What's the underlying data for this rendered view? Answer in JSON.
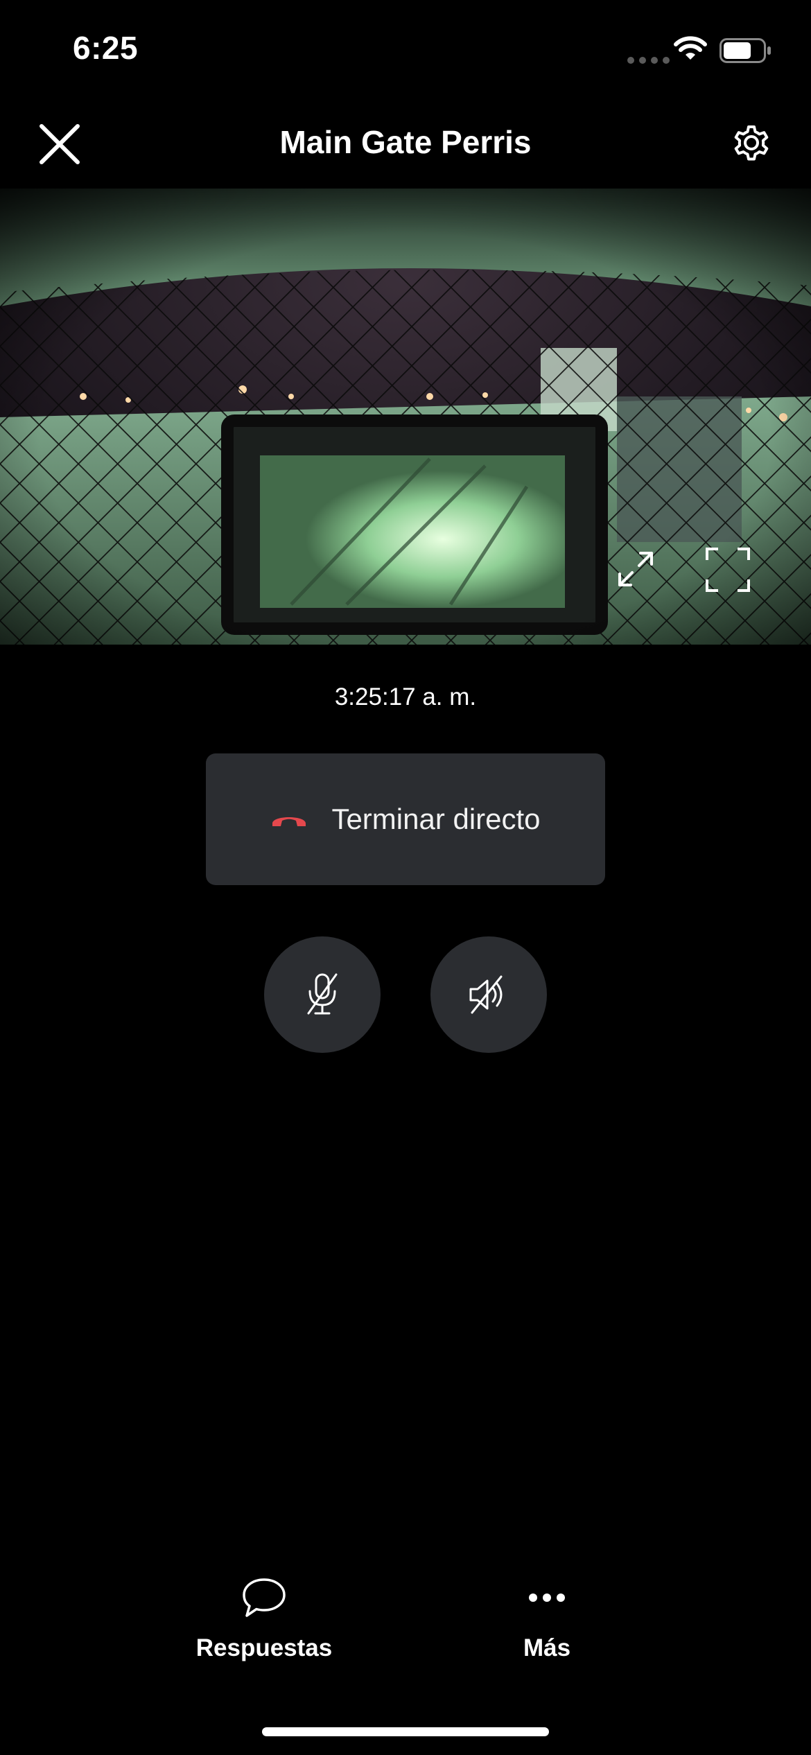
{
  "status_bar": {
    "time": "6:25",
    "battery_level": 0.7
  },
  "header": {
    "title": "Main Gate Perris",
    "close_icon": "close-icon",
    "settings_icon": "gear-icon"
  },
  "camera": {
    "timestamp": "3:25:17 a. m.",
    "expand_icon": "expand-arrows-icon",
    "fullscreen_icon": "fullscreen-corners-icon"
  },
  "live": {
    "end_label": "Terminar directo",
    "end_icon": "phone-hangup-icon",
    "end_icon_color": "#e5484d"
  },
  "controls": {
    "mic_icon": "mic-muted-icon",
    "speaker_icon": "speaker-muted-icon"
  },
  "bottom_nav": {
    "replies_label": "Respuestas",
    "replies_icon": "chat-bubble-icon",
    "more_label": "Más",
    "more_icon": "more-dots-icon"
  },
  "colors": {
    "background": "#000000",
    "button_bg": "#2b2d31",
    "accent_red": "#e5484d"
  }
}
